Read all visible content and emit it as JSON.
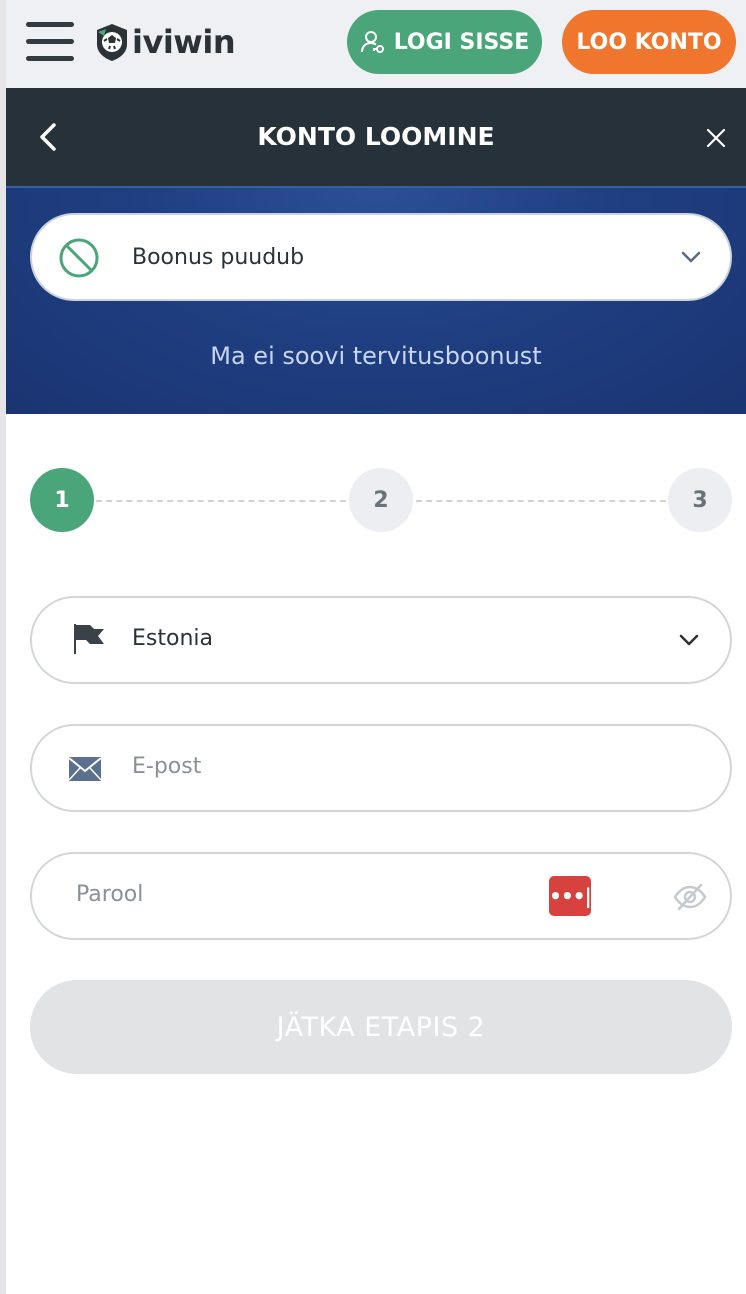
{
  "header": {
    "logo_text": "iviwin",
    "login_label": "LOGI SISSE",
    "register_label": "LOO KONTO"
  },
  "modal": {
    "title": "KONTO LOOMINE"
  },
  "bonus": {
    "selected": "Boonus puudub",
    "note": "Ma ei soovi tervitusboonust"
  },
  "steps": [
    "1",
    "2",
    "3"
  ],
  "current_step": 1,
  "form": {
    "country": "Estonia",
    "email_placeholder": "E-post",
    "password_placeholder": "Parool",
    "continue_label": "JÄTKA ETAPIS 2"
  },
  "colors": {
    "accent_green": "#4aa57a",
    "accent_orange": "#f0762e",
    "modal_bar": "#27313a",
    "banner_blue": "#1f3f82",
    "disabled_button": "#e2e3e5"
  },
  "icons": {
    "menu": "hamburger-icon",
    "login": "user-key-icon",
    "back": "chevron-left-icon",
    "close": "close-icon",
    "bonus": "no-bonus-icon",
    "dropdown": "chevron-down-icon",
    "country": "flag-icon",
    "email": "envelope-icon",
    "password_manager": "password-manager-icon",
    "password_visibility": "eye-slash-icon"
  }
}
